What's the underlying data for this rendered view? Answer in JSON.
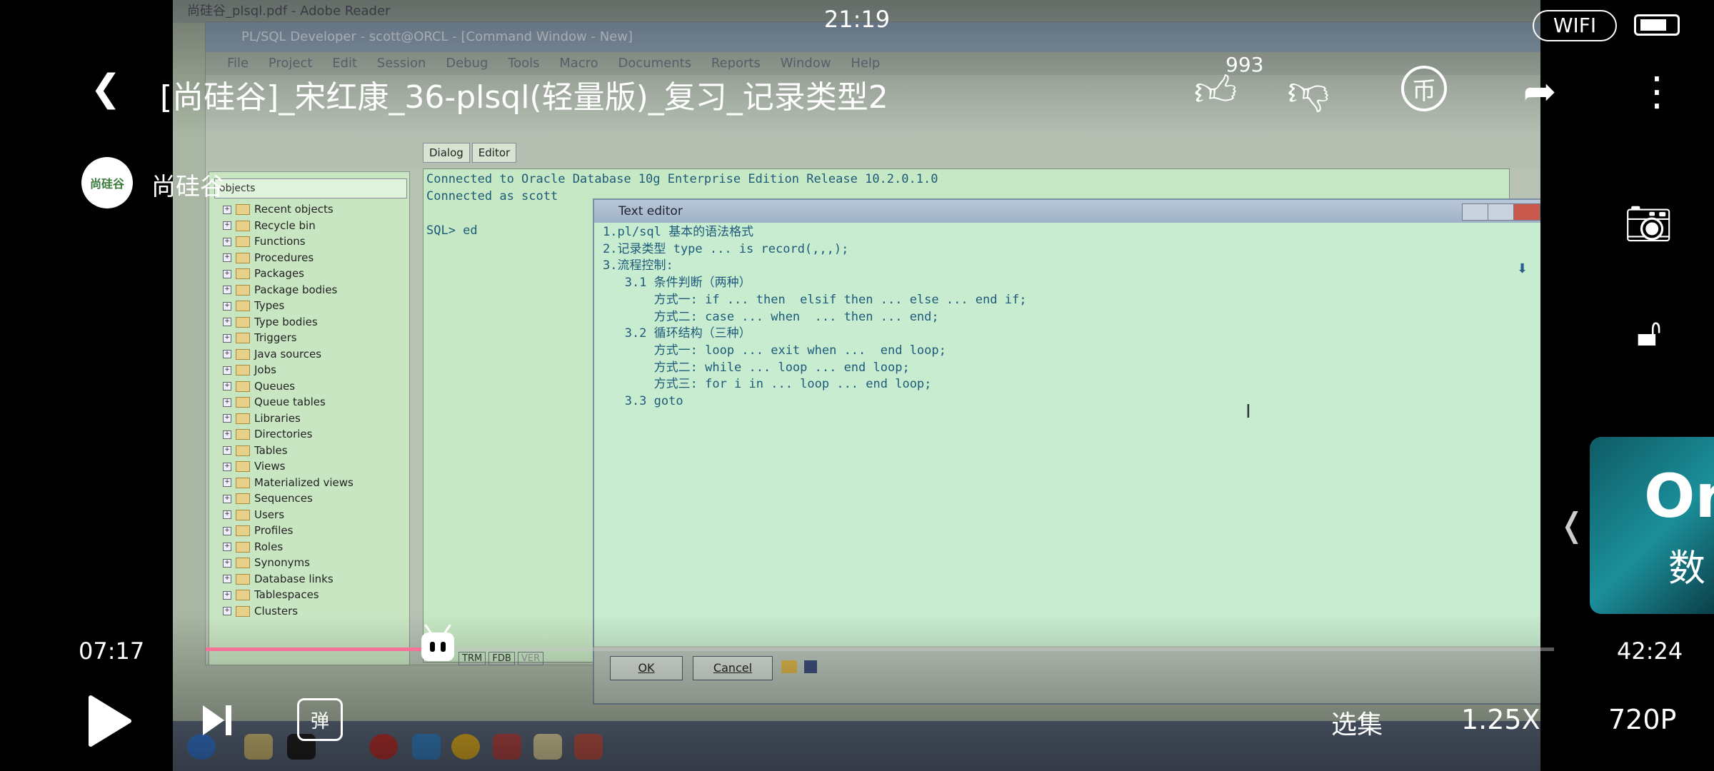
{
  "status_bar": {
    "time": "21:19",
    "network": "WIFI"
  },
  "video": {
    "title": "[尚硅谷]_宋红康_36-plsql(轻量版)_复习_记录类型2",
    "uploader": "尚硅谷",
    "avatar_text": "尚硅谷",
    "like_count": "993",
    "current_time": "07:17",
    "duration": "42:24",
    "progress": 0.172,
    "episodes_label": "选集",
    "speed_label": "1.25X",
    "quality_label": "720P",
    "side_card_text": "Or",
    "side_card_sub": "数"
  },
  "desktop": {
    "reader_title": "尚硅谷_plsql.pdf - Adobe Reader",
    "window_title": "PL/SQL Developer - scott@ORCL - [Command Window - New]",
    "menu": [
      "File",
      "Project",
      "Edit",
      "Session",
      "Debug",
      "Tools",
      "Macro",
      "Documents",
      "Reports",
      "Window",
      "Help"
    ],
    "object_browser": {
      "filter": "objects",
      "items": [
        "Recent objects",
        "Recycle bin",
        "Functions",
        "Procedures",
        "Packages",
        "Package bodies",
        "Types",
        "Type bodies",
        "Triggers",
        "Java sources",
        "Jobs",
        "Queues",
        "Queue tables",
        "Libraries",
        "Directories",
        "Tables",
        "Views",
        "Materialized views",
        "Sequences",
        "Users",
        "Profiles",
        "Roles",
        "Synonyms",
        "Database links",
        "Tablespaces",
        "Clusters"
      ]
    },
    "cmd_tabs": [
      "Dialog",
      "Editor"
    ],
    "cmd_lines": [
      "Connected to Oracle Database 10g Enterprise Edition Release 10.2.0.1.0",
      "Connected as scott",
      "",
      "SQL> ed"
    ],
    "status_tabs": [
      "TRM",
      "FDB",
      "VER"
    ],
    "text_editor": {
      "title": "Text editor",
      "lines": [
        "1.pl/sql 基本的语法格式",
        "2.记录类型 type ... is record(,,,);",
        "3.流程控制:",
        "   3.1 条件判断（两种）",
        "       方式一: if ... then  elsif then ... else ... end if;",
        "       方式二: case ... when  ... then ... end;",
        "   3.2 循环结构（三种）",
        "       方式一: loop ... exit when ...  end loop;",
        "       方式二: while ... loop ... end loop;",
        "       方式三: for i in ... loop ... end loop;",
        "   3.3 goto"
      ],
      "ok": "OK",
      "cancel": "Cancel"
    }
  },
  "colors": {
    "accent": "#fb7299"
  }
}
